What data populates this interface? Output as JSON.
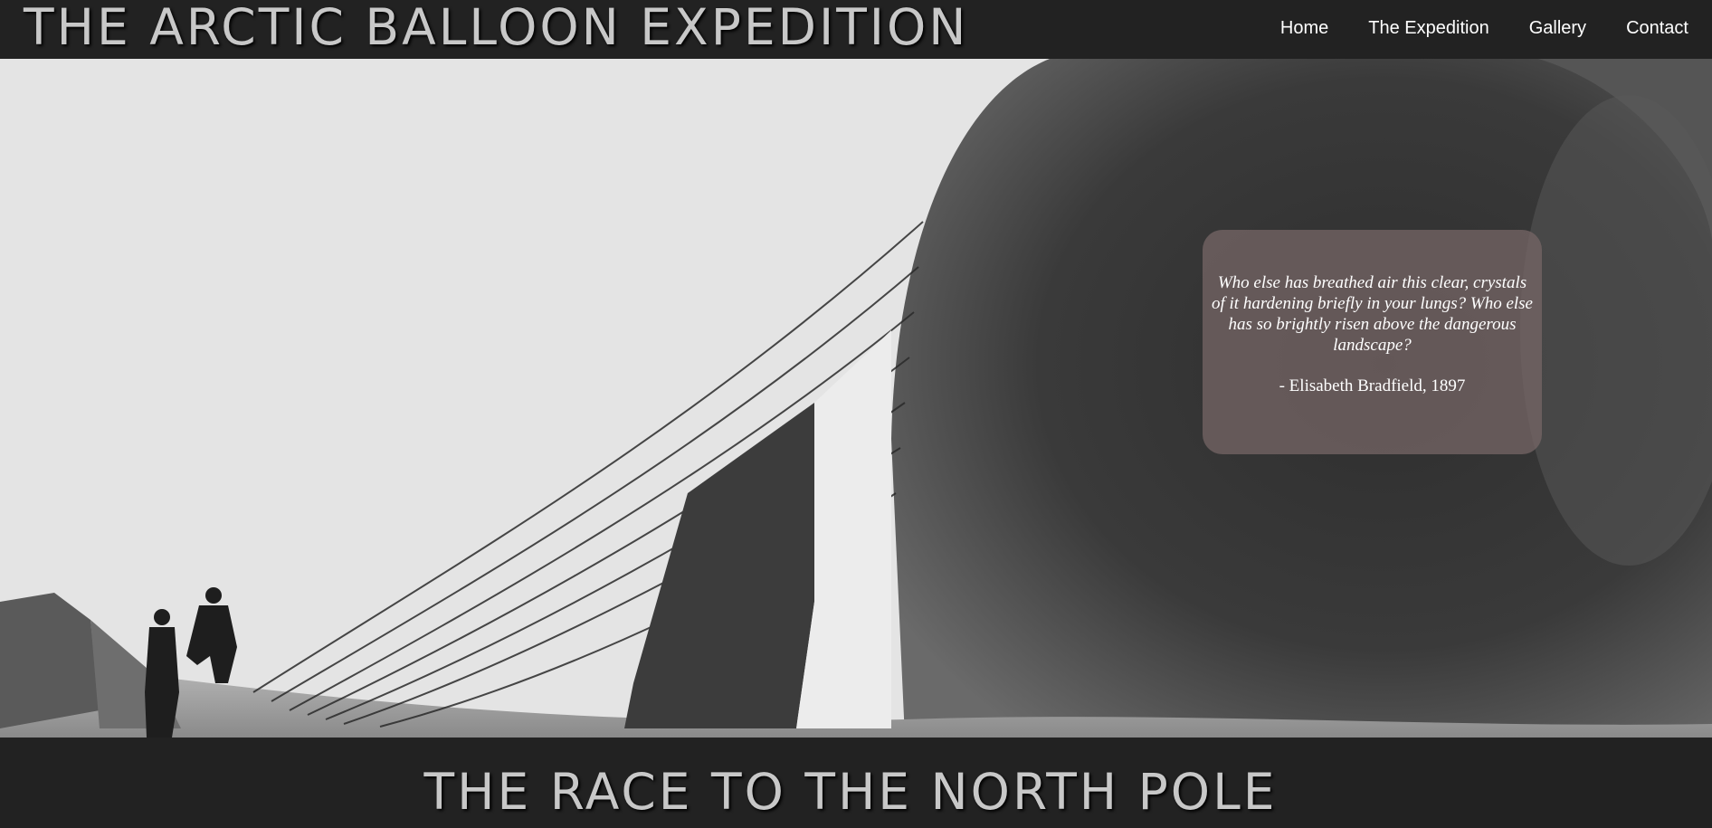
{
  "header": {
    "site_title": "THE ARCTIC BALLOON EXPEDITION",
    "nav": [
      {
        "label": "Home"
      },
      {
        "label": "The Expedition"
      },
      {
        "label": "Gallery"
      },
      {
        "label": "Contact"
      }
    ]
  },
  "hero": {
    "image": "black-and-white photo of a large deflated expedition balloon with netting and men standing on ice",
    "quote": {
      "text": "Who else has breathed air this clear, crystals of it hardening briefly in your lungs? Who else has so brightly risen above the dangerous landscape?",
      "attribution": "- Elisabeth Bradfield, 1897"
    }
  },
  "section": {
    "title": "THE RACE TO THE NORTH POLE"
  },
  "colors": {
    "header_bg": "#222222",
    "title_text": "#c8c8c8",
    "nav_text": "#ffffff",
    "quote_box_bg": "#786868"
  }
}
